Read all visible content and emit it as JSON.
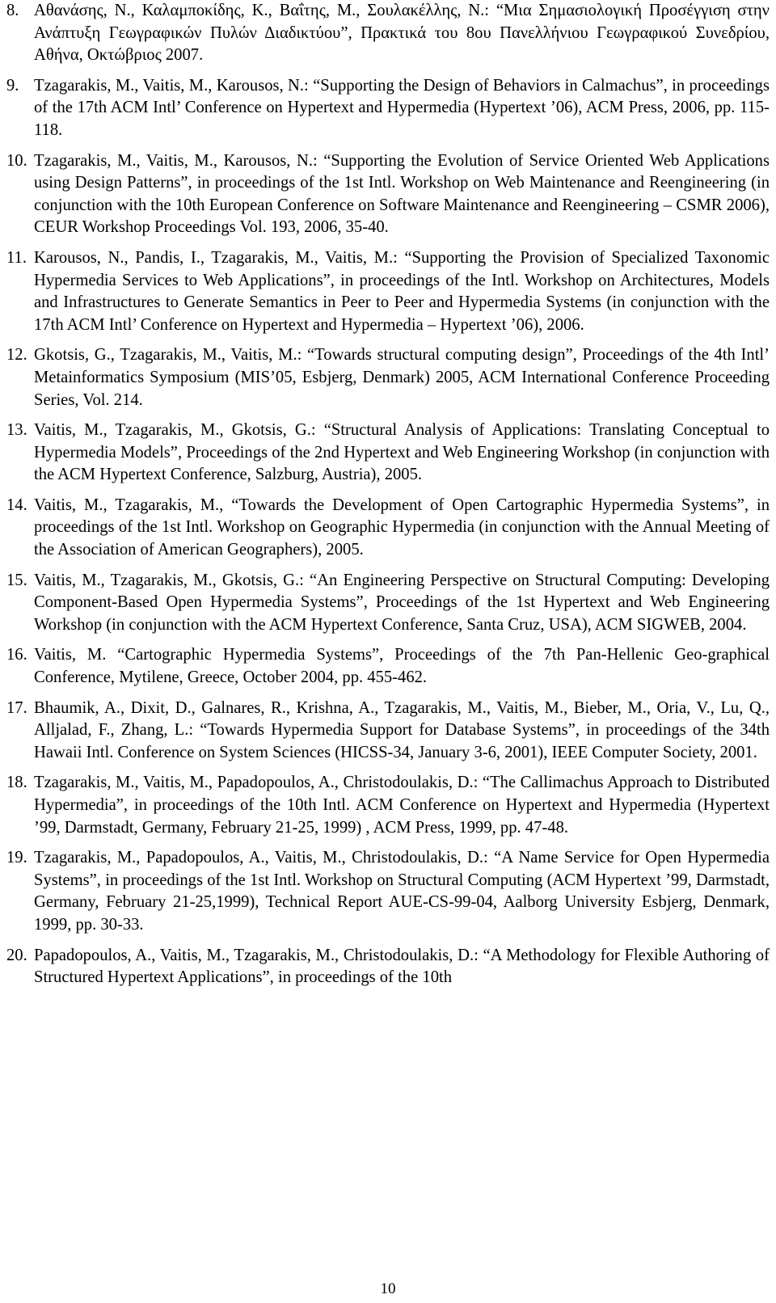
{
  "document": {
    "references": [
      {
        "number": "8.",
        "text": "Αθανάσης, Ν., Καλαμποκίδης, Κ., Βαΐτης, Μ., Σουλακέλλης, Ν.: “Μια Σημασιολογική Προσέγγιση στην Ανάπτυξη Γεωγραφικών Πυλών Διαδικτύου”, Πρακτικά του 8ου Πανελλήνιου Γεωγραφικού Συνεδρίου, Αθήνα, Οκτώβριος 2007."
      },
      {
        "number": "9.",
        "text": "Tzagarakis, M., Vaitis, M., Karousos, N.: “Supporting the Design of Behaviors in Cal­machus”, in proceedings of the 17th ACM Intl’ Conference on Hypertext and Hyper­media (Hypertext ’06), ACM Press, 2006, pp. 115-118."
      },
      {
        "number": "10.",
        "text": "Tzagarakis, M., Vaitis, M., Karousos, N.: “Supporting the Evolution of Service Oriented Web Applications using Design Patterns”, in proceedings of the 1st Intl. Workshop on Web Maintenance and Reengineering (in conjunction with the 10th European Confer­ence on Software Maintenance and Reengineering – CSMR 2006), CEUR Workshop Proceedings Vol. 193, 2006, 35-40."
      },
      {
        "number": "11.",
        "text": "Karousos, N., Pandis, I., Tzagarakis, M., Vaitis, M.: “Supporting the Provision of Spe­cialized Taxonomic Hypermedia Services to Web Applications”, in proceedings of the Intl. Workshop on Architectures, Models and Infrastructures to Generate Semantics in Peer to Peer and Hypermedia Systems (in conjunction with the 17th ACM Intl’ Confer­ence on Hypertext and Hypermedia – Hypertext ’06), 2006."
      },
      {
        "number": "12.",
        "text": "Gkotsis, G., Tzagarakis, M., Vaitis, M.: “Towards structural computing design”, Pro­ceedings of the 4th Intl’ Metainformatics Symposium (MIS’05, Esbjerg, Denmark) 2005, ACM International Conference Proceeding Series, Vol. 214."
      },
      {
        "number": "13.",
        "text": "Vaitis, M., Tzagarakis, M., Gkotsis, G.: “Structural Analysis of Applications: Translat­ing Conceptual to Hypermedia Models”, Proceedings of the 2nd Hypertext and Web En­gineering Workshop (in conjunction with the ACM Hypertext Conference, Salzburg, Austria), 2005."
      },
      {
        "number": "14.",
        "text": "Vaitis, M., Tzagarakis, M., “Towards the Development of Open Cartographic Hyperme­dia Systems”, in proceedings of the 1st Intl. Workshop on Geographic Hypermedia (in conjunction with the Annual Meeting of the Association of American Geographers), 2005."
      },
      {
        "number": "15.",
        "text": "Vaitis, M., Tzagarakis, M., Gkotsis, G.: “An Engineering Perspective on Structural Computing: Developing Component-Based Open Hypermedia Systems”, Proceedings of the 1st Hypertext and Web Engineering Workshop (in conjunction with the ACM Hyper­text Conference, Santa Cruz, USA), ACM SIGWEB, 2004."
      },
      {
        "number": "16.",
        "text": "Vaitis, M. “Cartographic Hypermedia Systems”, Proceedings of the 7th Pan-Hellenic Geo-graphical Conference, Mytilene, Greece, October 2004, pp. 455-462."
      },
      {
        "number": "17.",
        "text": "Bhaumik, A., Dixit, D., Galnares, R., Krishna, A., Tzagarakis, M., Vaitis, M., Bieber, M., Oria, V., Lu, Q., Alljalad, F., Zhang, L.: “Towards Hypermedia Support for Data­base Systems”, in proceedings of the 34th Hawaii Intl. Conference on System Sciences (HICSS-34, January 3-6, 2001), IEEE Computer Society, 2001."
      },
      {
        "number": "18.",
        "text": "Tzagarakis, M., Vaitis, M., Papadopoulos, A., Christodoulakis, D.: “The Callimachus Approach to Distributed Hypermedia”, in proceedings of the 10th Intl. ACM Conference on Hypertext and Hypermedia (Hypertext ’99, Darmstadt, Germany, February 21-25, 1999) , ACM Press, 1999, pp. 47-48."
      },
      {
        "number": "19.",
        "text": "Tzagarakis, M., Papadopoulos, A., Vaitis, M., Christodoulakis, D.: “A Name Service for Open Hypermedia Systems”, in proceedings of the 1st Intl. Workshop on Structural Computing (ACM Hypertext ’99, Darmstadt, Germany, February 21-25,1999), Tech­nical Report AUE-CS-99-04, Aalborg University Esbjerg, Denmark, 1999, pp. 30-33."
      },
      {
        "number": "20.",
        "text": "Papadopoulos, A., Vaitis, M., Tzagarakis, M., Christodoulakis, D.: “A Methodology for Flexible Authoring of Structured Hypertext Applications”, in proceedings of the 10th"
      }
    ],
    "page_number": "10"
  }
}
